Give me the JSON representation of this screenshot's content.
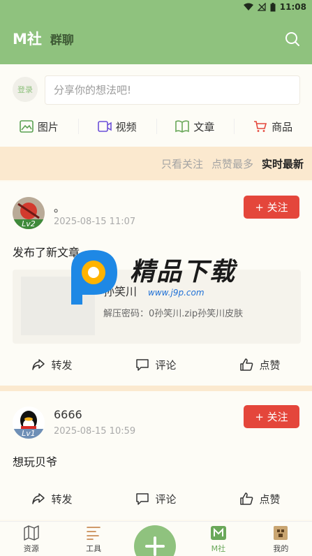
{
  "status_bar": {
    "time": "11:08"
  },
  "header": {
    "title": "M社",
    "subtitle": "群聊",
    "icons": {
      "search": "search-icon"
    }
  },
  "composer": {
    "login_label": "登录",
    "placeholder": "分享你的想法吧!",
    "categories": [
      {
        "label": "图片",
        "icon": "image-icon",
        "color": "#5aa152"
      },
      {
        "label": "视频",
        "icon": "video-icon",
        "color": "#6b4fd8"
      },
      {
        "label": "文章",
        "icon": "book-icon",
        "color": "#6aa85a"
      },
      {
        "label": "商品",
        "icon": "cart-icon",
        "color": "#e4463b"
      }
    ]
  },
  "filters": [
    {
      "label": "只看关注",
      "active": false
    },
    {
      "label": "点赞最多",
      "active": false
    },
    {
      "label": "实时最新",
      "active": true
    }
  ],
  "posts": [
    {
      "name": "。",
      "time": "2025-08-15 11:07",
      "level": "Lv2",
      "follow_label": "+ 关注",
      "text": "发布了新文章",
      "article": {
        "title": "孙笑川",
        "desc": "解压密码：0孙笑川.zip孙笑川皮肤"
      },
      "actions": {
        "share": "转发",
        "comment": "评论",
        "like": "点赞"
      }
    },
    {
      "name": "6666",
      "time": "2025-08-15 10:59",
      "level": "Lv1",
      "follow_label": "+ 关注",
      "text": "想玩贝爷",
      "actions": {
        "share": "转发",
        "comment": "评论",
        "like": "点赞"
      }
    }
  ],
  "watermark": {
    "text": "精品下载",
    "url": "www.j9p.com"
  },
  "bottom_nav": [
    {
      "label": "资源",
      "icon": "map-icon",
      "active": false
    },
    {
      "label": "工具",
      "icon": "tools-icon",
      "active": false
    },
    {
      "label": "M社",
      "icon": "m-community-icon",
      "active": true
    },
    {
      "label": "我的",
      "icon": "profile-icon",
      "active": false
    }
  ],
  "colors": {
    "header": "#8fc27e",
    "accent": "#e4463b",
    "filter_bar": "#fbe9cf",
    "background": "#fdf9ef"
  }
}
